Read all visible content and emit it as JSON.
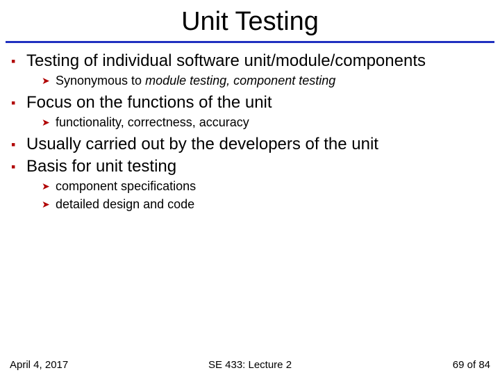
{
  "title": "Unit Testing",
  "items": [
    {
      "text": "Testing of individual software unit/module/components",
      "subs": [
        {
          "plain": "Synonymous to ",
          "em": "module testing, component testing"
        }
      ]
    },
    {
      "text": "Focus on the functions of the unit",
      "subs": [
        {
          "plain": "functionality, correctness, accuracy"
        }
      ]
    },
    {
      "text": "Usually carried out by the developers of the unit",
      "subs": []
    },
    {
      "text": "Basis for unit testing",
      "subs": [
        {
          "plain": "component specifications"
        },
        {
          "plain": "detailed design and code"
        }
      ]
    }
  ],
  "footer": {
    "date": "April 4, 2017",
    "center": "SE 433: Lecture 2",
    "page_current": "69",
    "page_sep": " of ",
    "page_total": "84"
  }
}
